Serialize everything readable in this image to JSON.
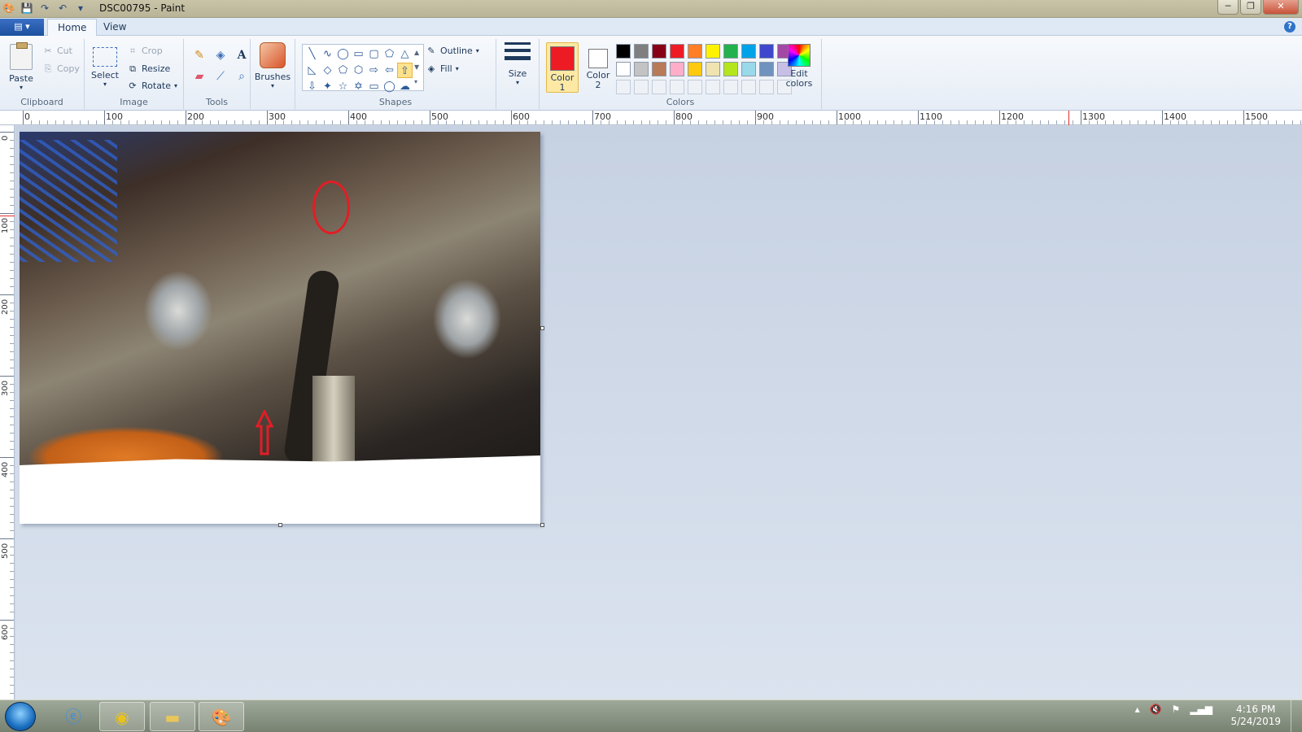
{
  "window": {
    "title": "DSC00795 - Paint",
    "controls": [
      "─",
      "❐",
      "✕"
    ]
  },
  "tabs": [
    {
      "label": "Home",
      "active": true
    },
    {
      "label": "View",
      "active": false
    }
  ],
  "ribbon": {
    "clipboard": {
      "paste": "Paste",
      "cut": "Cut",
      "copy": "Copy",
      "label": "Clipboard"
    },
    "image": {
      "select": "Select",
      "crop": "Crop",
      "resize": "Resize",
      "rotate": "Rotate",
      "label": "Image"
    },
    "tools": {
      "label": "Tools",
      "icons": [
        "pencil-icon",
        "fill-icon",
        "text-icon",
        "eraser-icon",
        "color-picker-icon",
        "magnifier-icon"
      ]
    },
    "brushes": {
      "label": "Brushes"
    },
    "shapes": {
      "label": "Shapes",
      "outline": "Outline",
      "fill": "Fill"
    },
    "size": {
      "label": "Size"
    },
    "colors": {
      "label": "Colors",
      "color1_label": "Color",
      "color1_sub": "1",
      "color2_label": "Color",
      "color2_sub": "2",
      "color1": "#ed1c24",
      "color2": "#ffffff",
      "edit_colors": "Edit colors",
      "palette_row1": [
        "#000000",
        "#7f7f7f",
        "#880015",
        "#ed1c24",
        "#ff7f27",
        "#fff200",
        "#22b14c",
        "#00a2e8",
        "#3f48cc",
        "#a349a4"
      ],
      "palette_row2": [
        "#ffffff",
        "#c3c3c3",
        "#b97a57",
        "#ffaec9",
        "#ffc90e",
        "#efe4b0",
        "#b5e61d",
        "#99d9ea",
        "#7092be",
        "#c8bfe7"
      ]
    }
  },
  "ruler": {
    "h_labels": [
      "0",
      "100",
      "200",
      "300",
      "400",
      "500",
      "600",
      "700",
      "800",
      "900",
      "1000",
      "1100",
      "1200",
      "1300",
      "1400",
      "1500"
    ],
    "v_labels": [
      "0",
      "100",
      "200",
      "300",
      "400",
      "500",
      "600"
    ]
  },
  "taskbar": {
    "time": "4:16 PM",
    "date": "5/24/2019",
    "apps": [
      "internet-explorer-icon",
      "chrome-icon",
      "file-explorer-icon",
      "paint-icon"
    ]
  }
}
